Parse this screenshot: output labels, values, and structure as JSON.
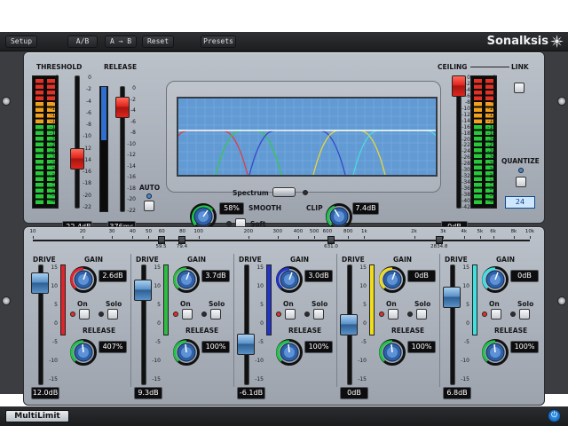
{
  "toolbar": {
    "setup": "Setup",
    "ab_a": "A",
    "ab_b": "B",
    "a_to_b": "A → B",
    "reset": "Reset",
    "presets": "Presets",
    "brand": "Sonalksis"
  },
  "main": {
    "threshold_label": "THRESHOLD",
    "release_label": "RELEASE",
    "threshold_value": "-22.4dB",
    "release_value": "376ms",
    "threshold_level": 0.35,
    "release_level": 0.9,
    "auto_label": "AUTO",
    "spectrum_label": "Spectrum",
    "smooth_label": "SMOOTH",
    "smooth_value": "58%",
    "soft_label": "Soft",
    "clip_label": "CLIP",
    "clip_value": "7.4dB",
    "ceiling_label": "CEILING",
    "ceiling_value": "0dB",
    "ceiling_level": 1.0,
    "link_label": "LINK",
    "quantize_label": "QUANTIZE",
    "quantize_value": "24",
    "meter_scale": [
      "0",
      "-2",
      "-4",
      "-6",
      "-8",
      "-10",
      "-12",
      "-14",
      "-16",
      "-18",
      "-20",
      "-22",
      "-24",
      "-26",
      "-28",
      "-30",
      "-32",
      "-34",
      "-36",
      "-38",
      "-40",
      "-42"
    ],
    "threshold_scale": [
      "0",
      "-2",
      "-4",
      "-6",
      "-8",
      "-10",
      "-12",
      "-14",
      "-16",
      "-18",
      "-20",
      "-22"
    ],
    "ceiling_scale": [
      "0",
      "-2",
      "-4",
      "-6",
      "-8",
      "-10",
      "-12",
      "-14",
      "-16",
      "-18",
      "-20",
      "-22",
      "-24",
      "-26",
      "-28",
      "-30",
      "-32",
      "-34",
      "-36",
      "-38",
      "-40",
      "-42"
    ]
  },
  "crossover": {
    "ticks": [
      "10",
      "20",
      "30",
      "40",
      "50",
      "60",
      "80",
      "100",
      "200",
      "300",
      "400",
      "500",
      "600",
      "800",
      "1k",
      "2k",
      "3k",
      "4k",
      "5k",
      "6k",
      "8k",
      "10k"
    ],
    "values": [
      "59.5",
      "79.4",
      "631.0",
      "2834.8"
    ]
  },
  "bands": [
    {
      "drive_label": "DRIVE",
      "gain_label": "GAIN",
      "gain_value": "2.6dB",
      "on_label": "On",
      "solo_label": "Solo",
      "release_label": "RELEASE",
      "release_value": "407%",
      "drive_value": "12.0dB",
      "drive_level": 0.92,
      "color": "#d8242b",
      "accent": "#e3232b"
    },
    {
      "drive_label": "DRIVE",
      "gain_label": "GAIN",
      "gain_value": "3.7dB",
      "on_label": "On",
      "solo_label": "Solo",
      "release_label": "RELEASE",
      "release_value": "100%",
      "drive_value": "9.3dB",
      "drive_level": 0.85,
      "color": "#1ebf3a",
      "accent": "#2ebd42"
    },
    {
      "drive_label": "DRIVE",
      "gain_label": "GAIN",
      "gain_value": "3.0dB",
      "on_label": "On",
      "solo_label": "Solo",
      "release_label": "RELEASE",
      "release_value": "100%",
      "drive_value": "-6.1dB",
      "drive_level": 0.3,
      "color": "#1b2fbf",
      "accent": "#2233c8"
    },
    {
      "drive_label": "DRIVE",
      "gain_label": "GAIN",
      "gain_value": "0dB",
      "on_label": "On",
      "solo_label": "Solo",
      "release_label": "RELEASE",
      "release_value": "100%",
      "drive_value": "0dB",
      "drive_level": 0.5,
      "color": "#e6d21a",
      "accent": "#f0dc1e"
    },
    {
      "drive_label": "DRIVE",
      "gain_label": "GAIN",
      "gain_value": "0dB",
      "on_label": "On",
      "solo_label": "Solo",
      "release_label": "RELEASE",
      "release_value": "100%",
      "drive_value": "6.8dB",
      "drive_level": 0.78,
      "color": "#31d6d6",
      "accent": "#3fe0e0"
    }
  ],
  "band_scale": [
    "15",
    "10",
    "5",
    "0",
    "-5",
    "-10",
    "-15"
  ],
  "footer": {
    "product": "MultiLimit"
  },
  "colors": {
    "accent_blue": "#4d8ccf",
    "panel": "#aab1ba",
    "led_green": "#28c83a",
    "led_red": "#e23226"
  }
}
